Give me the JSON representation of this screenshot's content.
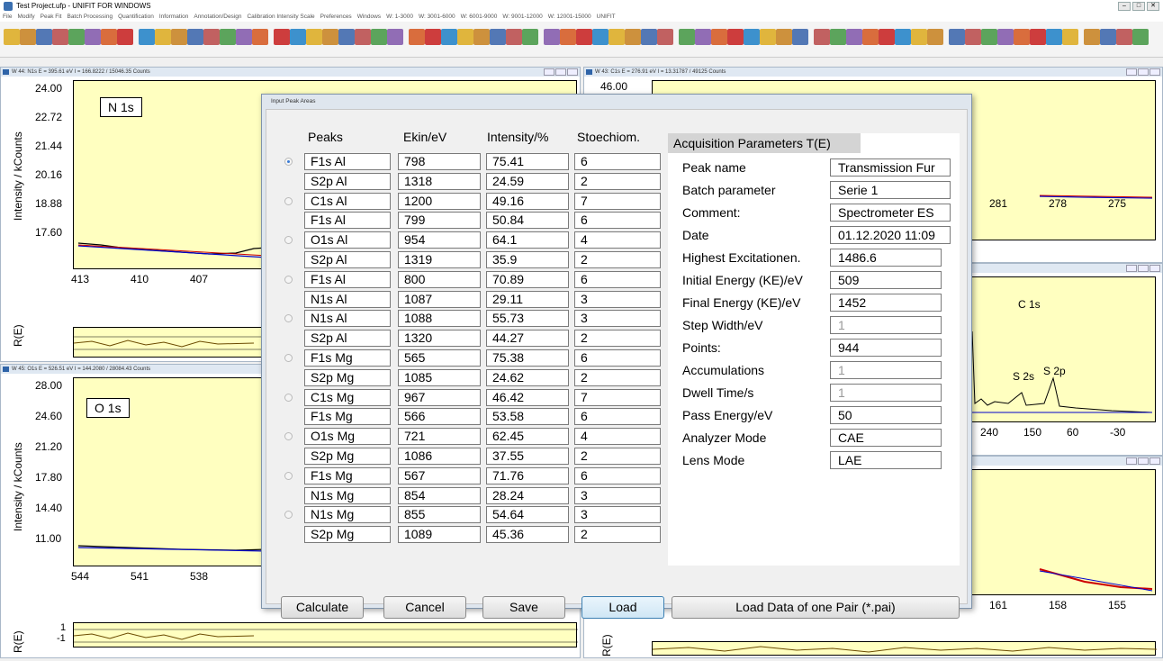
{
  "window": {
    "title": "Test Project.ufp - UNIFIT FOR WINDOWS"
  },
  "menu": [
    "File",
    "Modify",
    "Peak Fit",
    "Batch Processing",
    "Quantification",
    "Information",
    "Annotation/Design",
    "Calibration Intensity Scale",
    "Preferences",
    "Windows",
    "W: 1-3000",
    "W: 3001-6000",
    "W: 6001-9000",
    "W: 9001-12000",
    "W: 12001-15000",
    "UNIFIT"
  ],
  "windows": {
    "w44": {
      "caption": "W 44: N1s  E = 395.61 eV  I = 166.8222 / 15046.35 Counts",
      "label": "N 1s",
      "ylabel": "Intensity / kCounts",
      "yticks": [
        "24.00",
        "22.72",
        "21.44",
        "20.16",
        "18.88",
        "17.60"
      ],
      "xticks": [
        "413",
        "410",
        "407"
      ],
      "rlabel": "R(E)"
    },
    "w45": {
      "caption": "W 45: O1s  E = 526.51 eV  I = 144.2080 / 28084.43 Counts",
      "label": "O 1s",
      "ylabel": "Intensity / kCounts",
      "yticks": [
        "28.00",
        "24.60",
        "21.20",
        "17.80",
        "14.40",
        "11.00"
      ],
      "xticks": [
        "544",
        "541",
        "538"
      ],
      "rlabel": "R(E)",
      "rticks": [
        "1",
        "-1"
      ]
    },
    "w43": {
      "caption": "W 43: C1s  E = 276.91 eV  I = 13.31787 / 49125 Counts",
      "ytop": "46.00",
      "xticks": [
        "281",
        "278",
        "275"
      ]
    },
    "survey": {
      "labels": [
        "C 1s",
        "S 2s",
        "S 2p"
      ],
      "xticks": [
        "240",
        "150",
        "60",
        "-30"
      ]
    },
    "w4": {
      "xticks": [
        "161",
        "158",
        "155"
      ],
      "rlabel": "R(E)"
    }
  },
  "dialog": {
    "title": "Input Peak Areas",
    "headers": {
      "peaks": "Peaks",
      "ekin": "Ekin/eV",
      "intensity": "Intensity/%",
      "stoech": "Stoechiom."
    },
    "rows": [
      {
        "peak": "F1s  Al",
        "ekin": "798",
        "int": "75.41",
        "st": "6"
      },
      {
        "peak": "S2p  Al",
        "ekin": "1318",
        "int": "24.59",
        "st": "2"
      },
      {
        "peak": "C1s  Al",
        "ekin": "1200",
        "int": "49.16",
        "st": "7"
      },
      {
        "peak": "F1s  Al",
        "ekin": "799",
        "int": "50.84",
        "st": "6"
      },
      {
        "peak": "O1s  Al",
        "ekin": "954",
        "int": "64.1",
        "st": "4"
      },
      {
        "peak": "S2p  Al",
        "ekin": "1319",
        "int": "35.9",
        "st": "2"
      },
      {
        "peak": "F1s  Al",
        "ekin": "800",
        "int": "70.89",
        "st": "6"
      },
      {
        "peak": "N1s Al",
        "ekin": "1087",
        "int": "29.11",
        "st": "3"
      },
      {
        "peak": "N1s  Al",
        "ekin": "1088",
        "int": "55.73",
        "st": "3"
      },
      {
        "peak": "S2p  Al",
        "ekin": "1320",
        "int": "44.27",
        "st": "2"
      },
      {
        "peak": "F1s  Mg",
        "ekin": "565",
        "int": "75.38",
        "st": "6"
      },
      {
        "peak": "S2p  Mg",
        "ekin": "1085",
        "int": "24.62",
        "st": "2"
      },
      {
        "peak": "C1s  Mg",
        "ekin": "967",
        "int": "46.42",
        "st": "7"
      },
      {
        "peak": "F1s  Mg",
        "ekin": "566",
        "int": "53.58",
        "st": "6"
      },
      {
        "peak": "O1s  Mg",
        "ekin": "721",
        "int": "62.45",
        "st": "4"
      },
      {
        "peak": "S2p  Mg",
        "ekin": "1086",
        "int": "37.55",
        "st": "2"
      },
      {
        "peak": "F1s Mg",
        "ekin": "567",
        "int": "71.76",
        "st": "6"
      },
      {
        "peak": "N1s  Mg",
        "ekin": "854",
        "int": "28.24",
        "st": "3"
      },
      {
        "peak": "N1s  Mg",
        "ekin": "855",
        "int": "54.64",
        "st": "3"
      },
      {
        "peak": "S2p  Mg",
        "ekin": "1089",
        "int": "45.36",
        "st": "2"
      }
    ],
    "params_header": "Acquisition Parameters T(E)",
    "params": [
      {
        "label": "Peak name",
        "value": "Transmission Fur",
        "disabled": false
      },
      {
        "label": "Batch parameter",
        "value": "Serie 1",
        "disabled": false
      },
      {
        "label": "Comment:",
        "value": "Spectrometer ES",
        "disabled": false
      },
      {
        "label": "Date",
        "value": "01.12.2020 11:09",
        "disabled": false
      },
      {
        "label": "Highest Excitationen.",
        "value": "1486.6",
        "disabled": false
      },
      {
        "label": "Initial Energy (KE)/eV",
        "value": "509",
        "disabled": false
      },
      {
        "label": "Final Energy (KE)/eV",
        "value": "1452",
        "disabled": false
      },
      {
        "label": "Step Width/eV",
        "value": "1",
        "disabled": true
      },
      {
        "label": "Points:",
        "value": "944",
        "disabled": false
      },
      {
        "label": "Accumulations",
        "value": "1",
        "disabled": true
      },
      {
        "label": "Dwell Time/s",
        "value": "1",
        "disabled": true
      },
      {
        "label": "Pass Energy/eV",
        "value": "50",
        "disabled": false
      },
      {
        "label": "Analyzer Mode",
        "value": "CAE",
        "disabled": false
      },
      {
        "label": "Lens Mode",
        "value": "LAE",
        "disabled": false
      }
    ],
    "buttons": {
      "calculate": "Calculate",
      "cancel": "Cancel",
      "save": "Save",
      "load": "Load",
      "load_pair": "Load Data of one Pair (*.pai)"
    }
  },
  "colors": {
    "plot_bg": "#ffffc0",
    "fit_line": "#0000cc",
    "data_line": "#000000",
    "envelope": "#cc0000"
  }
}
